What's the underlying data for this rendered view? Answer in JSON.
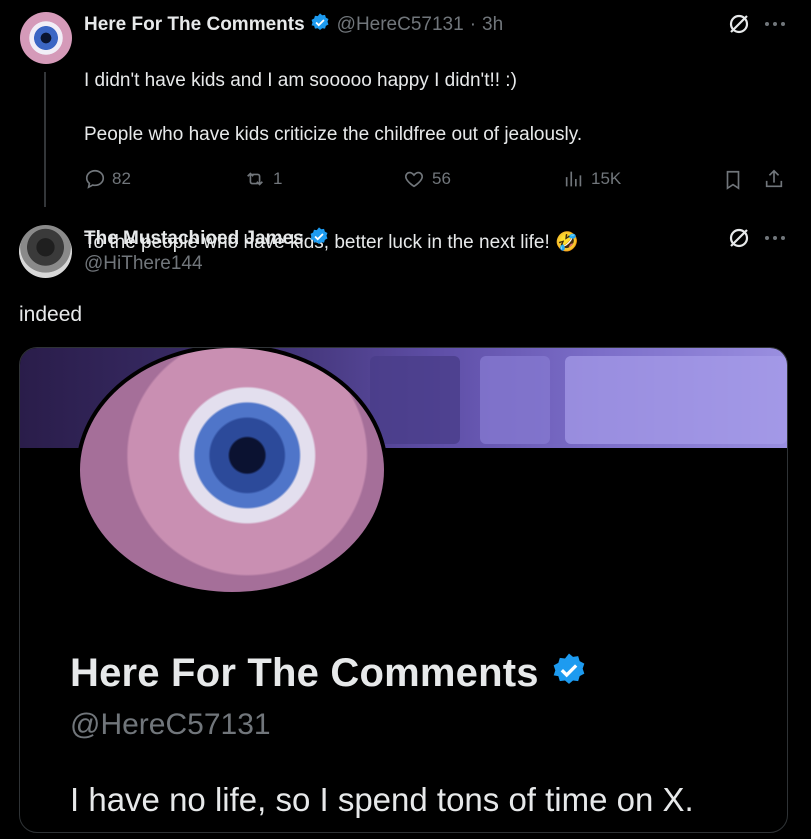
{
  "tweet1": {
    "display_name": "Here For The Comments",
    "handle": "@HereC57131",
    "sep": "·",
    "time": "3h",
    "line1": "I didn't have kids and I am sooooo happy I didn't!! :)",
    "line2": "People who have kids criticize the childfree out of jealously.",
    "line3": "To the people who have kids, better luck in the next life! 🤣",
    "replies": "82",
    "reposts": "1",
    "likes": "56",
    "views": "15K"
  },
  "tweet2": {
    "display_name": "The Mustachioed James",
    "handle": "@HiThere144",
    "text": "indeed"
  },
  "card": {
    "display_name": "Here For The Comments",
    "handle": "@HereC57131",
    "bio": "I have no life, so I spend tons of time on X."
  },
  "icons": {
    "verified": "verified-badge-icon",
    "grok": "grok-icon",
    "more": "more-icon",
    "reply": "reply-icon",
    "repost": "repost-icon",
    "like": "like-icon",
    "views": "views-icon",
    "bookmark": "bookmark-icon",
    "share": "share-icon"
  },
  "colors": {
    "verified": "#1d9bf0",
    "text": "#e7e9ea",
    "muted": "#71767b",
    "background": "#000000"
  }
}
